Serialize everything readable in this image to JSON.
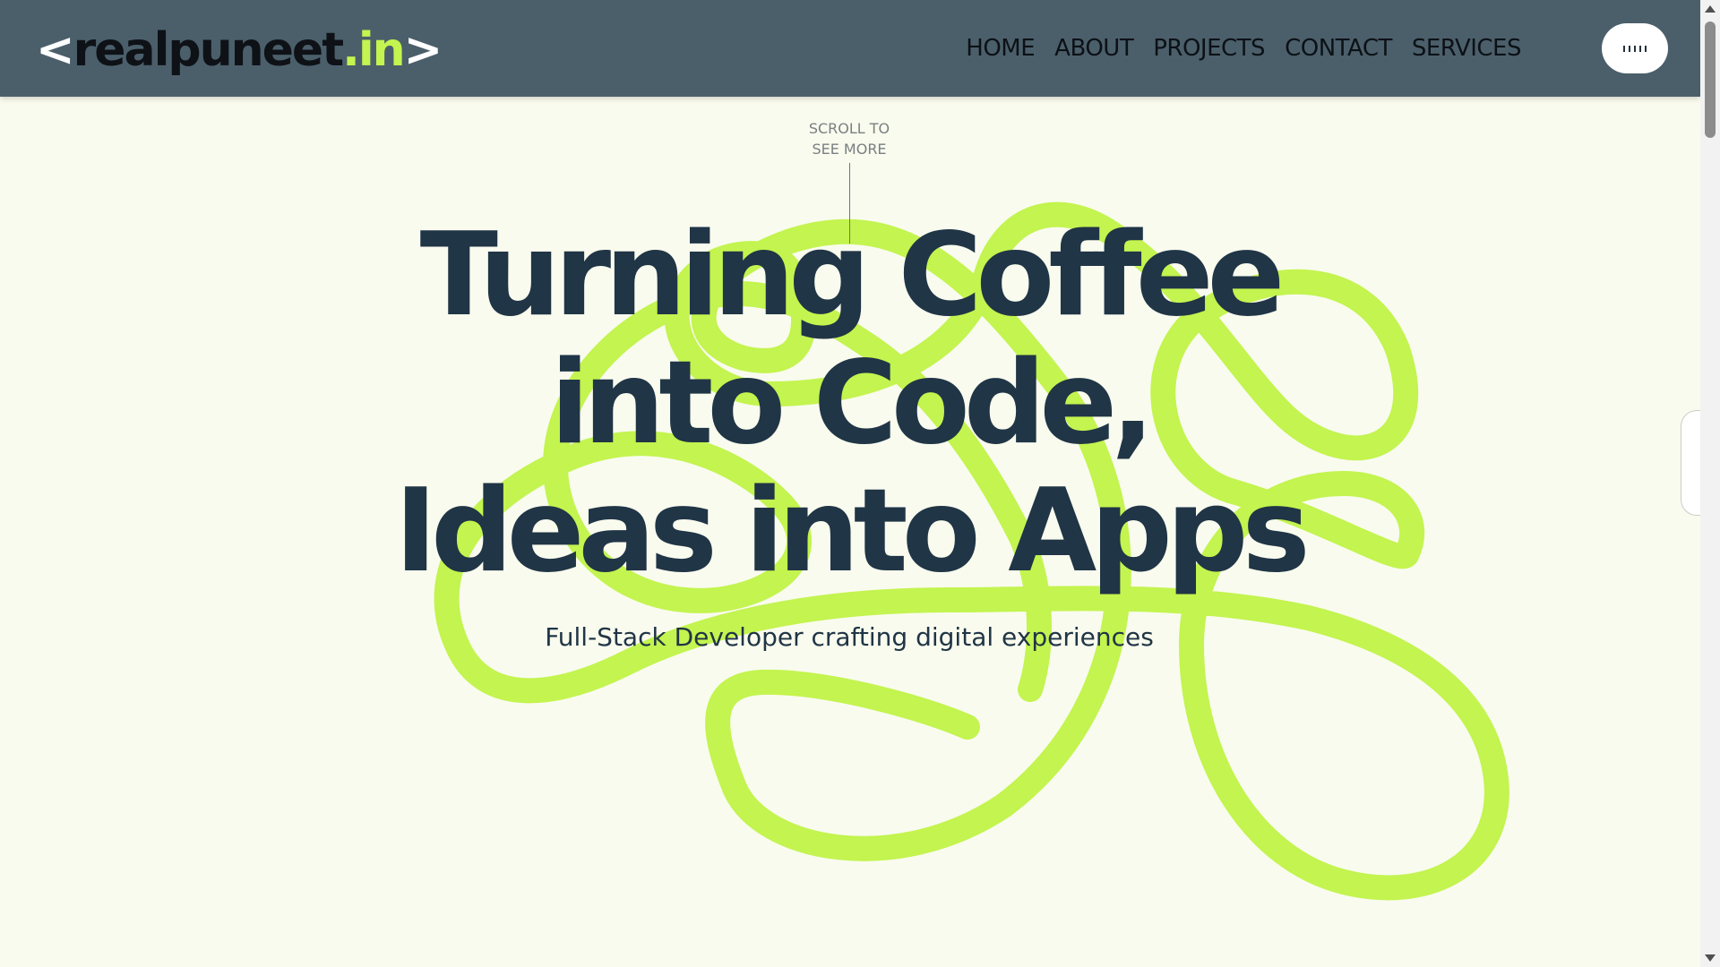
{
  "colors": {
    "navbar": "#4b5f6b",
    "background": "#f9fbee",
    "accent": "#c3f44f",
    "headline": "#203546"
  },
  "logo": {
    "open_bracket": "<",
    "name": "realpuneet",
    "tld": ".in",
    "close_bracket": ">"
  },
  "nav": {
    "links": [
      "HOME",
      "ABOUT",
      "PROJECTS",
      "CONTACT",
      "SERVICES"
    ],
    "menu_icon": "dots-menu-icon"
  },
  "scroll_hint": {
    "line1": "SCROLL TO",
    "line2": "SEE MORE"
  },
  "hero": {
    "title_lines": [
      "Turning Coffee",
      "into Code,",
      "Ideas into Apps"
    ],
    "subtitle": "Full-Stack Developer crafting digital experiences"
  }
}
